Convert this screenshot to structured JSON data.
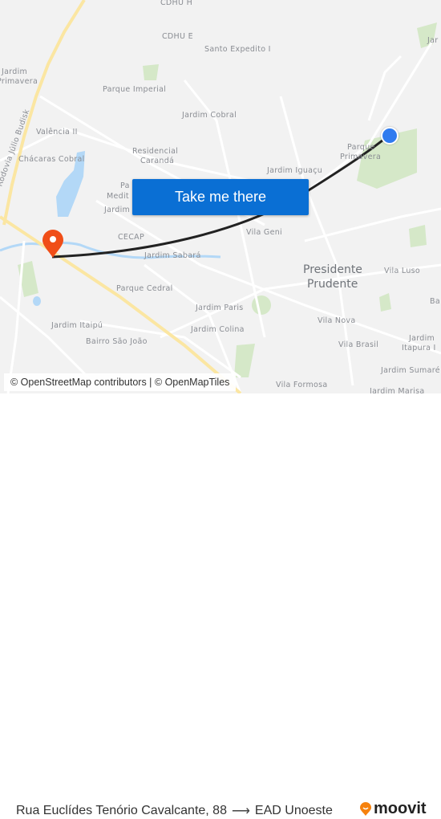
{
  "map": {
    "labels": [
      {
        "text": "CDHU H"
      },
      {
        "text": "CDHU E"
      },
      {
        "text": "Santo Expedito I"
      },
      {
        "text": "Jardim"
      },
      {
        "text": "Primavera"
      },
      {
        "text": "Parque Imperial"
      },
      {
        "text": "Jardim Cobral"
      },
      {
        "text": "Rodovia Júlio Budisk"
      },
      {
        "text": "Valência II"
      },
      {
        "text": "Residencial"
      },
      {
        "text": "Carandá"
      },
      {
        "text": "Chácaras Cobral"
      },
      {
        "text": "Jardim Iguaçu"
      },
      {
        "text": "Parque"
      },
      {
        "text": "Primavera"
      },
      {
        "text": "Jar"
      },
      {
        "text": "CECAP"
      },
      {
        "text": "Jardim Sabará"
      },
      {
        "text": "Vila Geni"
      },
      {
        "text": "Presidente"
      },
      {
        "text": "Prudente"
      },
      {
        "text": "Vila Luso"
      },
      {
        "text": "Parque Cedral"
      },
      {
        "text": "Jardim Paris"
      },
      {
        "text": "Jardim Colina"
      },
      {
        "text": "Jardim Itaipú"
      },
      {
        "text": "Bairro São João"
      },
      {
        "text": "Vila Nova"
      },
      {
        "text": "Vila Brasil"
      },
      {
        "text": "Jardim"
      },
      {
        "text": "Itapura I"
      },
      {
        "text": "Jardim Sumaré"
      },
      {
        "text": "Vila Formosa"
      },
      {
        "text": "Jardim Marisa"
      },
      {
        "text": "Ba"
      },
      {
        "text": "Pa"
      },
      {
        "text": "Medit"
      },
      {
        "text": "Jardim"
      }
    ],
    "origin_marker": "blue-dot",
    "destination_marker": "orange-pin",
    "colors": {
      "route": "#222222",
      "origin": "#2f7bef",
      "destination": "#f04e18",
      "water": "#b3d8f7",
      "park": "#d5e8c8",
      "highway": "#fbe6a2"
    }
  },
  "cta": {
    "label": "Take me there"
  },
  "attribution": {
    "text": "© OpenStreetMap contributors | © OpenMapTiles"
  },
  "footer": {
    "origin": "Rua Euclídes Tenório Cavalcante, 88",
    "arrow": "⟶",
    "destination": "EAD Unoeste",
    "brand": "moovit",
    "brand_color": "#f6820d"
  }
}
